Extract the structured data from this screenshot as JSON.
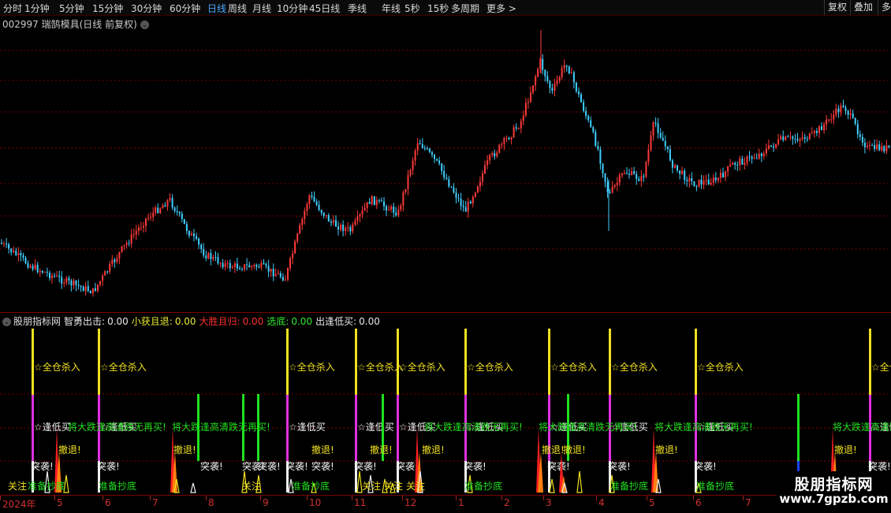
{
  "toolbar": {
    "periods": [
      "分时",
      "1分钟",
      "5分钟",
      "15分钟",
      "30分钟",
      "60分钟",
      "日线",
      "周线",
      "月线",
      "10分钟",
      "45日线",
      "季线",
      "年线",
      "5秒",
      "15秒",
      "多周期",
      "更多 >"
    ],
    "active": "日线",
    "right_buttons": [
      "复权",
      "叠加",
      "多"
    ]
  },
  "chart_title": "002997 瑞鹄模具(日线 前复权)",
  "indicator": {
    "name": "股朋指标网",
    "fields": [
      {
        "label": "智勇出击:",
        "value": "0.00",
        "color": "#e8e8e8"
      },
      {
        "label": "小获且退:",
        "value": "0.00",
        "color": "#e8e830"
      },
      {
        "label": "大胜且归:",
        "value": "0.00",
        "color": "#ff3030"
      },
      {
        "label": "选底:",
        "value": "0.00",
        "color": "#30e830"
      },
      {
        "label": "出逢低买:",
        "value": "0.00",
        "color": "#e8e8e8"
      }
    ]
  },
  "signal_labels": {
    "buy_all": "☆全仓杀入",
    "low_buy": "☆逢低买",
    "crash_buy": "将大跌逢高清跌无再买!",
    "retreat": "撤退!",
    "breakout": "突袭!",
    "prepare": "准备抄底",
    "watch": "关注"
  },
  "x_axis_labels": [
    "2024年",
    "5",
    "6",
    "7",
    "8",
    "9",
    "10",
    "11",
    "12",
    "1",
    "2",
    "3",
    "4",
    "5",
    "6",
    "7"
  ],
  "watermark": {
    "line1": "股朋指标网",
    "line2": "www.7gpzb.com"
  },
  "colors": {
    "up": "#ff3a3a",
    "down": "#40d0ff",
    "grid": "#7a0000"
  }
}
